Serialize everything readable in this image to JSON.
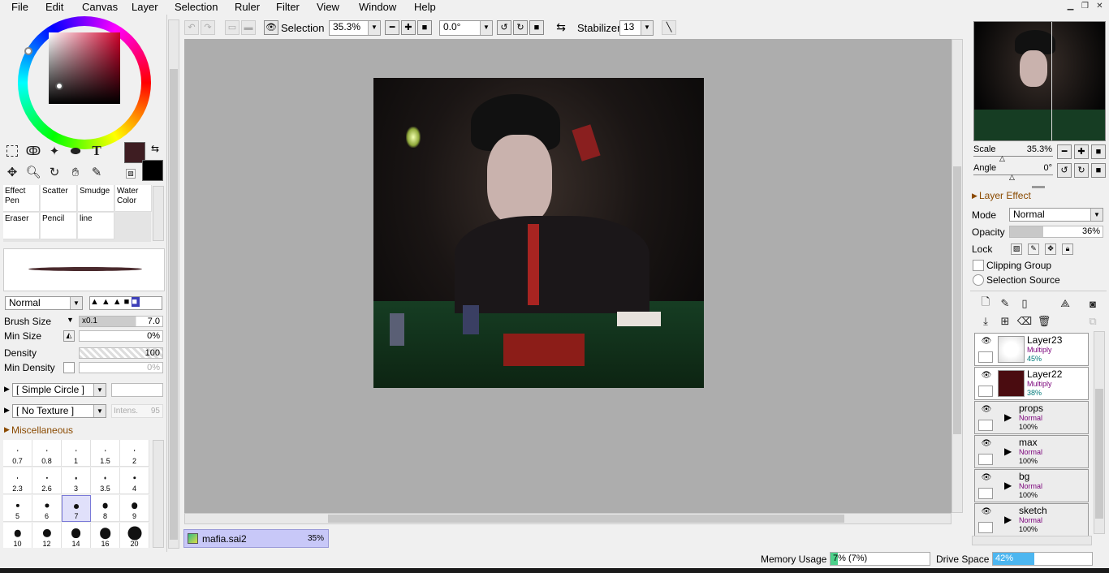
{
  "menu": {
    "items": [
      "File",
      "Edit",
      "Canvas",
      "Layer",
      "Selection",
      "Ruler",
      "Filter",
      "View",
      "Window",
      "Help"
    ]
  },
  "toolbar": {
    "selection_label": "Selection",
    "zoom_value": "35.3%",
    "angle_value": "0.0°",
    "stabilizer_label": "Stabilizer",
    "stabilizer_value": "13"
  },
  "colors": {
    "primary": "#3e1d22",
    "secondary": "#000000",
    "accent": "#3d7fe0"
  },
  "tools": {
    "brushes": [
      {
        "label1": "Effect",
        "label2": "Pen"
      },
      {
        "label1": "Scatter",
        "label2": ""
      },
      {
        "label1": "Smudge",
        "label2": ""
      },
      {
        "label1": "Water",
        "label2": "Color"
      },
      {
        "label1": "Eraser",
        "label2": ""
      },
      {
        "label1": "Pencil",
        "label2": ""
      },
      {
        "label1": "line",
        "label2": ""
      }
    ]
  },
  "brush": {
    "blend_mode": "Normal",
    "size_label": "Brush Size",
    "size_multiplier": "x0.1",
    "size_value": "7.0",
    "min_size_label": "Min Size",
    "min_size_value": "0%",
    "density_label": "Density",
    "density_value": "100",
    "min_density_label": "Min Density",
    "min_density_value": "0%",
    "shape": "[ Simple Circle ]",
    "texture": "[ No Texture ]",
    "texture_intensity_label": "Intens.",
    "texture_intensity_value": "95",
    "misc_label": "Miscellaneous",
    "sizes": [
      "0.7",
      "0.8",
      "1",
      "1.5",
      "2",
      "2.3",
      "2.6",
      "3",
      "3.5",
      "4",
      "5",
      "6",
      "7",
      "8",
      "9",
      "10",
      "12",
      "14",
      "16",
      "20"
    ],
    "selected_size": "7"
  },
  "document": {
    "tab_name": "mafia.sai2",
    "tab_zoom": "35%"
  },
  "navigator": {
    "scale_label": "Scale",
    "scale_value": "35.3%",
    "angle_label": "Angle",
    "angle_value": "0°"
  },
  "layer_panel": {
    "header": "Layer Effect",
    "mode_label": "Mode",
    "mode_value": "Normal",
    "opacity_label": "Opacity",
    "opacity_value": "36%",
    "opacity_fraction": 0.36,
    "lock_label": "Lock",
    "clipping_label": "Clipping Group",
    "selection_source_label": "Selection Source",
    "layers": [
      {
        "name": "Layer23",
        "mode": "Multiply",
        "opacity": "45%",
        "type": "layer"
      },
      {
        "name": "Layer22",
        "mode": "Multiply",
        "opacity": "38%",
        "type": "layer"
      },
      {
        "name": "props",
        "mode": "Normal",
        "opacity": "100%",
        "type": "folder"
      },
      {
        "name": "max",
        "mode": "Normal",
        "opacity": "100%",
        "type": "folder"
      },
      {
        "name": "bg",
        "mode": "Normal",
        "opacity": "100%",
        "type": "folder"
      },
      {
        "name": "sketch",
        "mode": "Normal",
        "opacity": "100%",
        "type": "folder"
      }
    ]
  },
  "status": {
    "memory_label": "Memory Usage",
    "memory_value": "7% (7%)",
    "memory_fraction": 0.07,
    "drive_label": "Drive Space",
    "drive_value": "42%",
    "drive_fraction": 0.42
  }
}
